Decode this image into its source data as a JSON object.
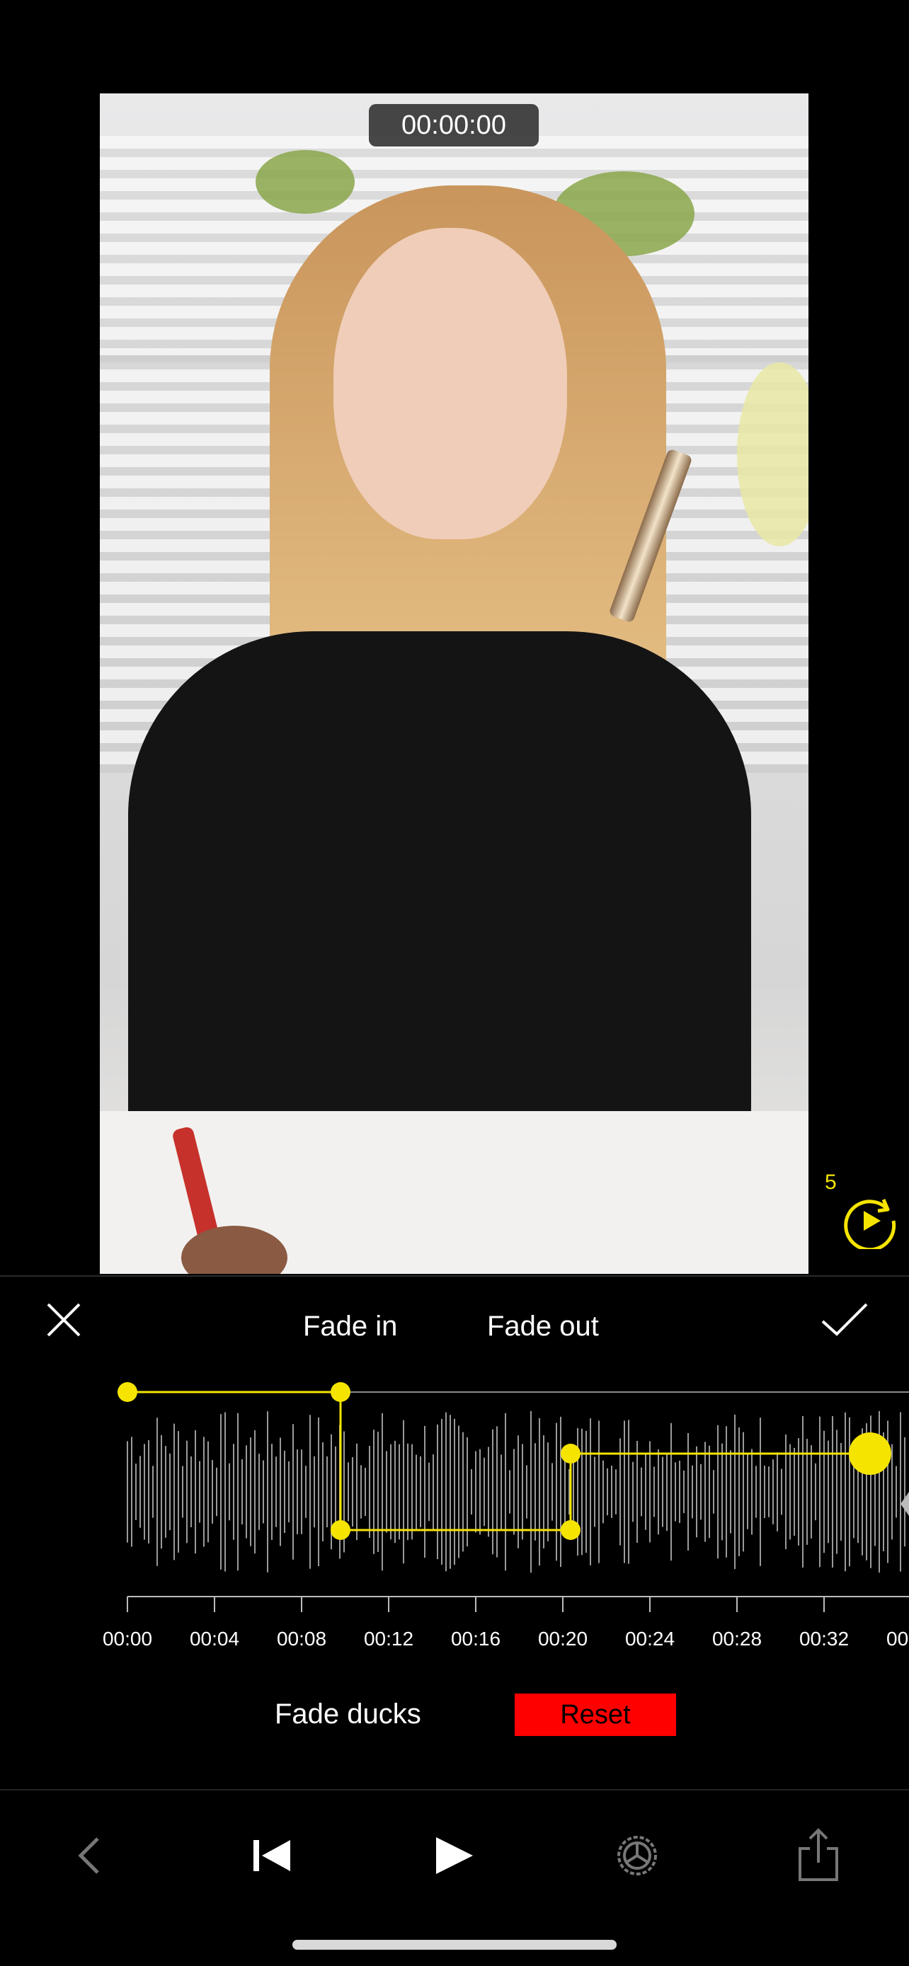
{
  "video": {
    "timecode": "00:00:00"
  },
  "replay": {
    "count": "5"
  },
  "panel": {
    "tabs": [
      {
        "label": "Fade in"
      },
      {
        "label": "Fade out"
      }
    ],
    "timeline_labels": [
      "00:00",
      "00:04",
      "00:08",
      "00:12",
      "00:16",
      "00:20",
      "00:24",
      "00:28",
      "00:32",
      "00"
    ],
    "fade_ducks_label": "Fade ducks",
    "reset_label": "Reset"
  },
  "colors": {
    "accent": "#f5e400",
    "reset": "#ff0000",
    "background": "#000000"
  },
  "toolbar": {
    "icons": [
      "back-chevron-icon",
      "skip-to-start-icon",
      "play-icon",
      "settings-icon",
      "share-icon"
    ]
  }
}
